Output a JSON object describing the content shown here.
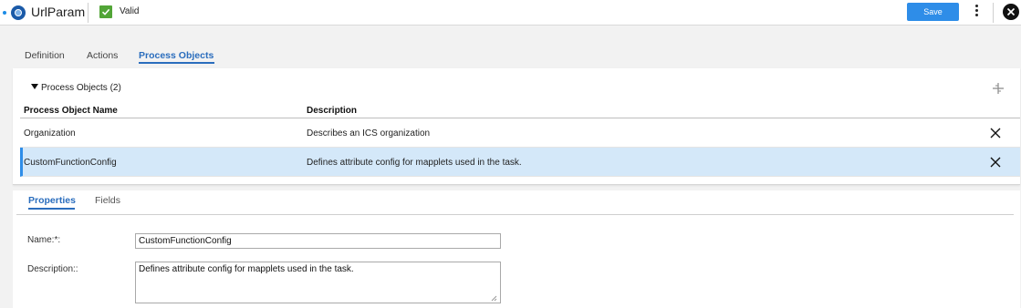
{
  "header": {
    "title": "UrlParam",
    "status_label": "Valid",
    "save_label": "Save",
    "status_color": "#52a537",
    "accent_color": "#2e8de8"
  },
  "main_tabs": [
    {
      "label": "Definition"
    },
    {
      "label": "Actions"
    },
    {
      "label": "Process Objects",
      "active": true
    }
  ],
  "process_objects": {
    "section_label": "Process Objects (2)",
    "columns": [
      "Process Object Name",
      "Description"
    ],
    "rows": [
      {
        "name": "Organization",
        "description": "Describes an ICS organization"
      },
      {
        "name": "CustomFunctionConfig",
        "description": "Defines attribute config for mapplets used in the task.",
        "selected": true
      }
    ]
  },
  "sub_tabs": [
    {
      "label": "Properties",
      "active": true
    },
    {
      "label": "Fields"
    }
  ],
  "properties": {
    "name_label": "Name:*:",
    "name_value": "CustomFunctionConfig",
    "description_label": "Description::",
    "description_value": "Defines attribute config for mapplets used in the task."
  },
  "icons": [
    "process-icon",
    "valid-check-icon",
    "more-vertical-icon",
    "close-icon",
    "collapse-triangle-icon",
    "add-icon",
    "delete-icon",
    "resize-grip-icon"
  ]
}
